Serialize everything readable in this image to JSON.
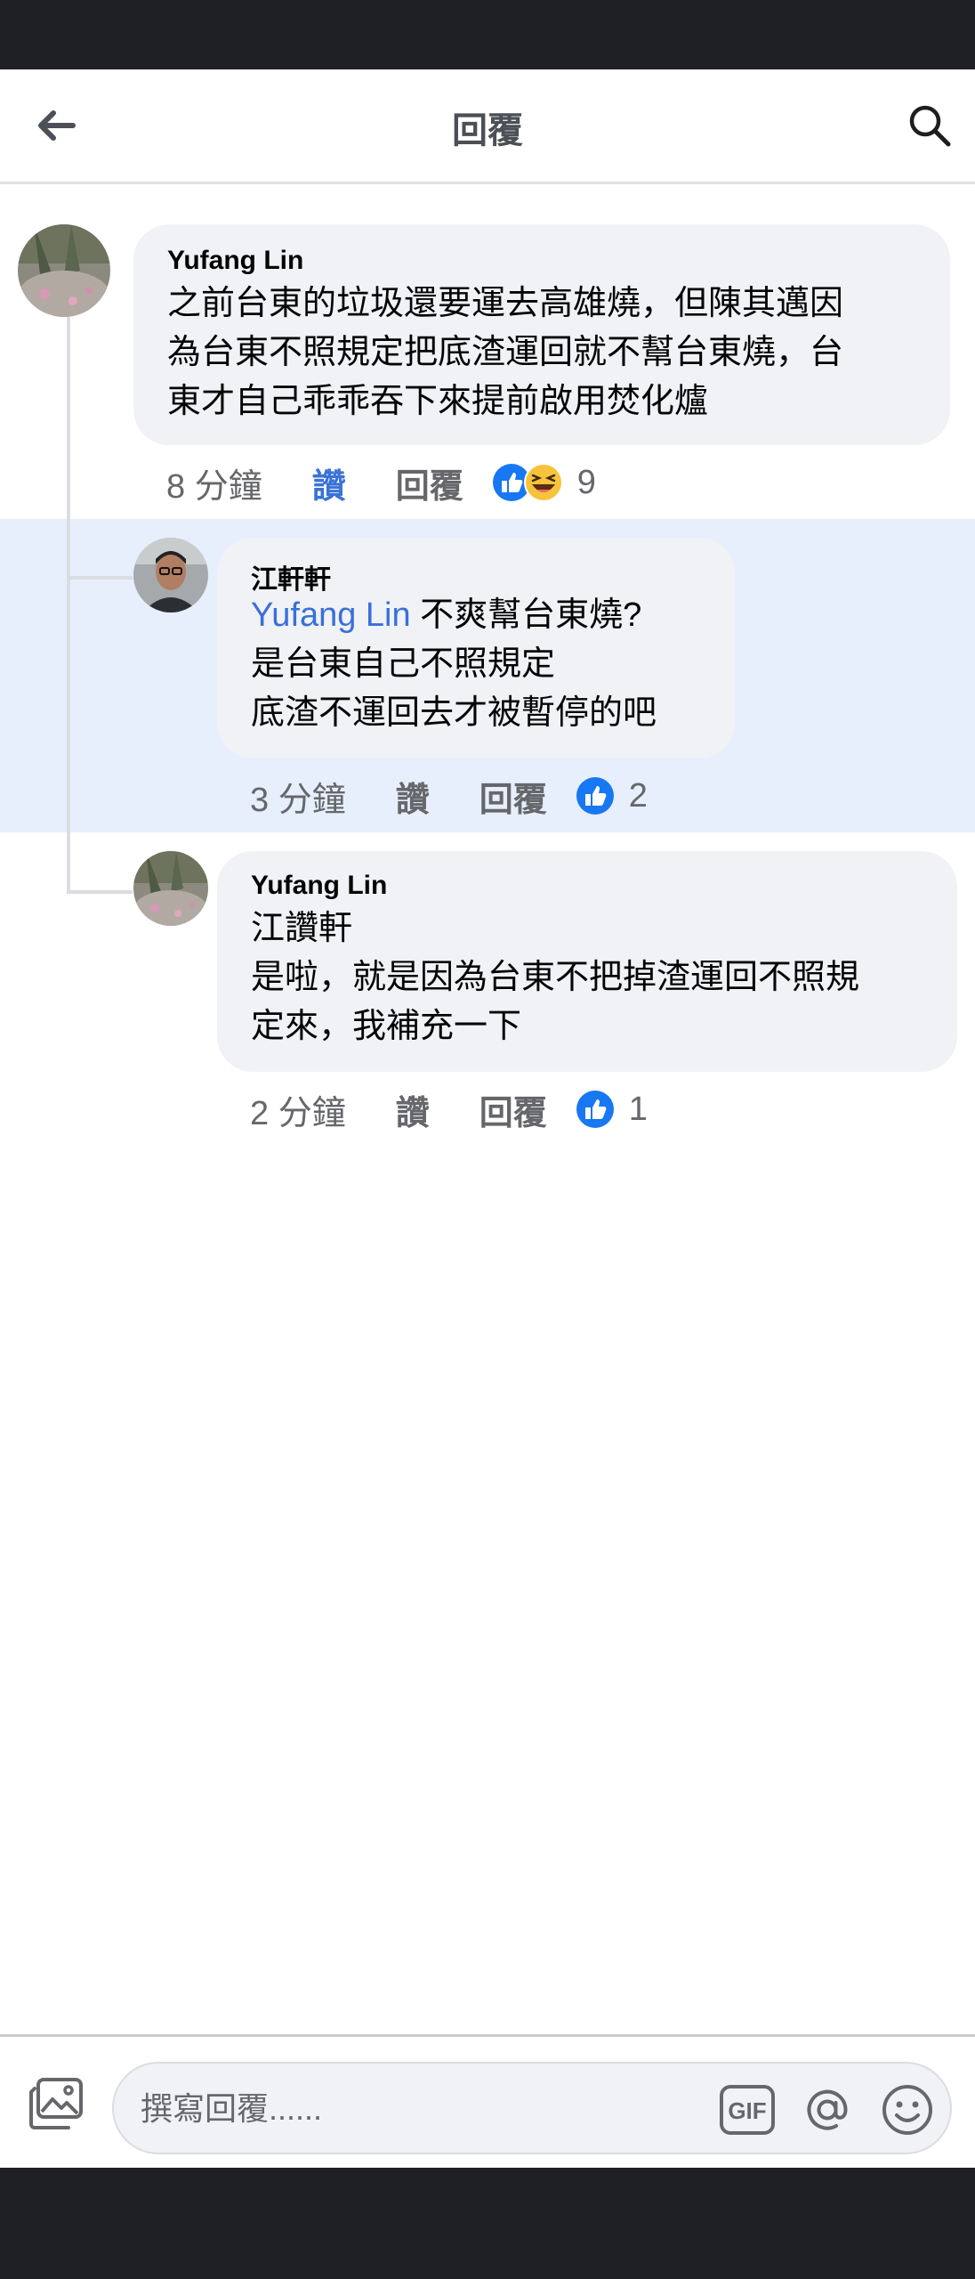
{
  "header": {
    "title": "回覆",
    "back_icon": "arrow-left-icon",
    "search_icon": "search-icon"
  },
  "comments": [
    {
      "author": "Yufang Lin",
      "lines": [
        "之前台東的垃圾還要運去高雄燒，但陳其邁因",
        "為台東不照規定把底渣運回就不幫台東燒，台",
        "東才自己乖乖吞下來提前啟用焚化爐"
      ],
      "time": "8 分鐘",
      "like_label": "讚",
      "liked": true,
      "reply_label": "回覆",
      "reactions": [
        "like",
        "haha"
      ],
      "reaction_count": "9"
    },
    {
      "author": "江軒軒",
      "mention": "Yufang Lin",
      "lines": [
        " 不爽幫台東燒?",
        "是台東自己不照規定",
        "底渣不運回去才被暫停的吧"
      ],
      "time": "3 分鐘",
      "like_label": "讚",
      "liked": false,
      "reply_label": "回覆",
      "reactions": [
        "like"
      ],
      "reaction_count": "2"
    },
    {
      "author": "Yufang Lin",
      "lines": [
        "江讚軒",
        "是啦，就是因為台東不把掉渣運回不照規",
        "定來，我補充一下"
      ],
      "time": "2 分鐘",
      "like_label": "讚",
      "liked": false,
      "reply_label": "回覆",
      "reactions": [
        "like"
      ],
      "reaction_count": "1"
    }
  ],
  "composer": {
    "placeholder": "撰寫回覆......",
    "value": "",
    "gif_label": "GIF",
    "photo_icon": "photo-icon",
    "mention_icon": "at-sign-icon",
    "emoji_icon": "emoji-icon"
  },
  "colors": {
    "accent": "#3a73d6",
    "mention": "#3a6fd8",
    "highlight": "#e7effc",
    "bubble": "#f0f2f5",
    "bars": "#1f2023"
  }
}
